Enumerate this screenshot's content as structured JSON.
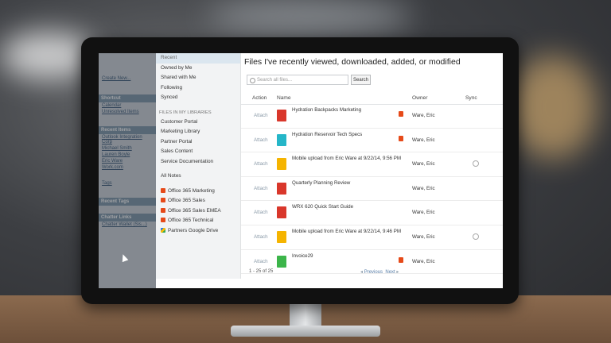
{
  "sidebar_salesforce": {
    "items": [
      "Create New...",
      "Shortcut",
      "Calendar",
      "Unresolved Items",
      "Recent Items",
      "Outlook Integration Corp",
      "Michael Smith",
      "Lauren Boyle",
      "Eric Ware",
      "Work.com",
      "Tags",
      "Recent Tags",
      "Chatter Links",
      "Chatter Wallet (Sis...)"
    ]
  },
  "nav": {
    "recent": "Recent",
    "owned": "Owned by Me",
    "shared": "Shared with Me",
    "following": "Following",
    "synced": "Synced",
    "libraries_header": "FILES IN MY LIBRARIES",
    "libraries": [
      "Customer Portal",
      "Marketing Library",
      "Partner Portal",
      "Sales Content",
      "Service Documentation"
    ],
    "all_notes": "All Notes",
    "external": [
      {
        "label": "Office 365 Marketing",
        "icon": "office365-icon"
      },
      {
        "label": "Office 365 Sales",
        "icon": "office365-icon"
      },
      {
        "label": "Office 365 Sales EMEA",
        "icon": "office365-icon"
      },
      {
        "label": "Office 365 Technical",
        "icon": "office365-icon"
      },
      {
        "label": "Partners Google Drive",
        "icon": "google-drive-icon"
      }
    ]
  },
  "main": {
    "title": "Files I've recently viewed, downloaded, added, or modified",
    "search_placeholder": "Search all files...",
    "search_button": "Search",
    "columns": {
      "action": "Action",
      "name": "Name",
      "owner": "Owner",
      "sync": "Sync"
    },
    "rows": [
      {
        "action": "Attach",
        "name": "Hydration Backpacks Marketing",
        "owner": "Ware, Eric",
        "icon": "ppt",
        "o365": true,
        "sync": false
      },
      {
        "action": "Attach",
        "name": "Hydration Reservoir Tech Specs",
        "owner": "Ware, Eric",
        "icon": "teal",
        "o365": true,
        "sync": false
      },
      {
        "action": "Attach",
        "name": "Mobile upload from Eric Ware at 9/22/14, 9:56 PM",
        "owner": "Ware, Eric",
        "icon": "pen",
        "o365": false,
        "sync": true
      },
      {
        "action": "Attach",
        "name": "Quarterly Planning Review",
        "owner": "Ware, Eric",
        "icon": "ppt",
        "o365": false,
        "sync": false
      },
      {
        "action": "Attach",
        "name": "WRX 620 Quick Start Guide",
        "owner": "Ware, Eric",
        "icon": "pdf",
        "o365": false,
        "sync": false
      },
      {
        "action": "Attach",
        "name": "Mobile upload from Eric Ware at 9/22/14, 9:46 PM",
        "owner": "Ware, Eric",
        "icon": "pen",
        "o365": false,
        "sync": true
      },
      {
        "action": "Attach",
        "name": "Invoice29",
        "owner": "Ware, Eric",
        "icon": "green",
        "o365": true,
        "sync": false
      }
    ],
    "footer": {
      "count": "1 - 25 of 25",
      "previous": "Previous",
      "next": "Next"
    }
  }
}
